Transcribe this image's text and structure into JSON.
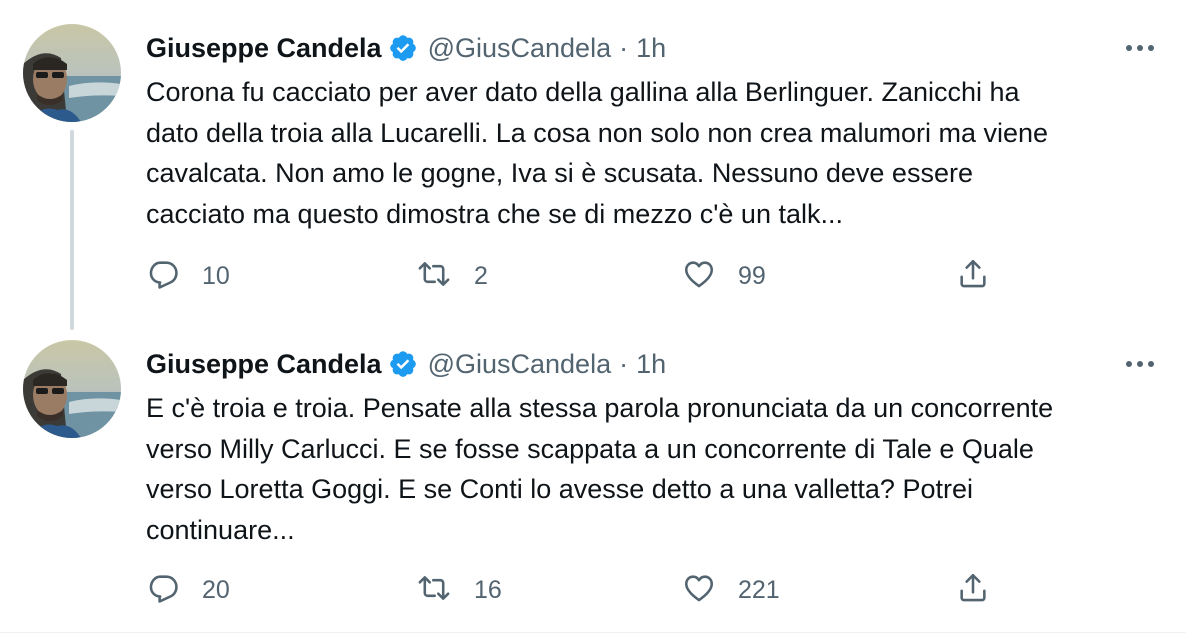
{
  "tweets": [
    {
      "author": "Giuseppe Candela",
      "handle": "@GiusCandela",
      "separator": "·",
      "time": "1h",
      "text": "Corona fu cacciato per aver dato della gallina alla Berlinguer. Zanicchi ha\ndato della troia alla Lucarelli. La cosa non solo non crea malumori ma viene\ncavalcata. Non amo le gogne, Iva si è scusata. Nessuno deve essere\ncacciato ma questo dimostra che se di mezzo c'è un talk...",
      "replies": "10",
      "retweets": "2",
      "likes": "99"
    },
    {
      "author": "Giuseppe Candela",
      "handle": "@GiusCandela",
      "separator": "·",
      "time": "1h",
      "text": "E c'è troia e troia. Pensate alla stessa parola pronunciata da un concorrente\nverso Milly Carlucci. E se fosse scappata a un concorrente di Tale e Quale\nverso Loretta Goggi. E se Conti lo avesse detto a una valletta? Potrei\ncontinuare...",
      "replies": "20",
      "retweets": "16",
      "likes": "221"
    }
  ],
  "icons": {
    "verified": "verified-badge-icon",
    "more": "more-horizontal-icon",
    "reply": "reply-bubble-icon",
    "retweet": "retweet-arrows-icon",
    "like": "heart-icon",
    "share": "share-upload-icon"
  },
  "colors": {
    "text": "#0f1419",
    "secondary": "#536471",
    "verified": "#1d9bf0",
    "thread_line": "#cfd9de"
  }
}
